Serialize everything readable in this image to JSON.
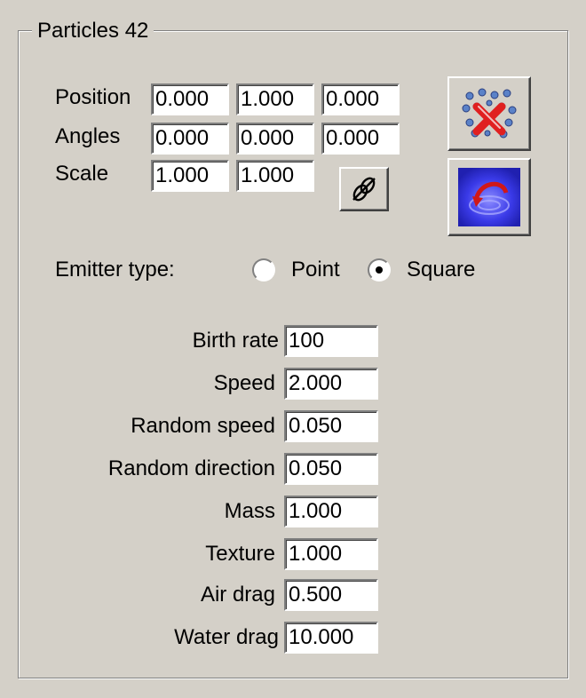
{
  "group": {
    "title": "Particles 42"
  },
  "transform": {
    "position": {
      "label": "Position",
      "values": [
        "0.000",
        "1.000",
        "0.000"
      ]
    },
    "angles": {
      "label": "Angles",
      "values": [
        "0.000",
        "0.000",
        "0.000"
      ]
    },
    "scale": {
      "label": "Scale",
      "values": [
        "1.000",
        "1.000"
      ]
    }
  },
  "emitter": {
    "label": "Emitter type:",
    "options": [
      "Point",
      "Square"
    ],
    "selected": "Square"
  },
  "params": {
    "birth_rate": {
      "label": "Birth rate",
      "value": "100"
    },
    "speed": {
      "label": "Speed",
      "value": "2.000"
    },
    "random_speed": {
      "label": "Random speed",
      "value": "0.050"
    },
    "random_direction": {
      "label": "Random direction",
      "value": "0.050"
    },
    "mass": {
      "label": "Mass",
      "value": "1.000"
    },
    "texture": {
      "label": "Texture",
      "value": "1.000"
    },
    "air_drag": {
      "label": "Air drag",
      "value": "0.500"
    },
    "water_drag": {
      "label": "Water drag",
      "value": "10.000"
    }
  },
  "icons": {
    "lock_scale": "link-icon",
    "delete": "delete-particles-icon",
    "reset": "reset-ripple-icon"
  },
  "colors": {
    "face": "#d4d0c8",
    "field": "#ffffff",
    "delete_x": "#e02020",
    "ripple": "#3a3ae8"
  }
}
